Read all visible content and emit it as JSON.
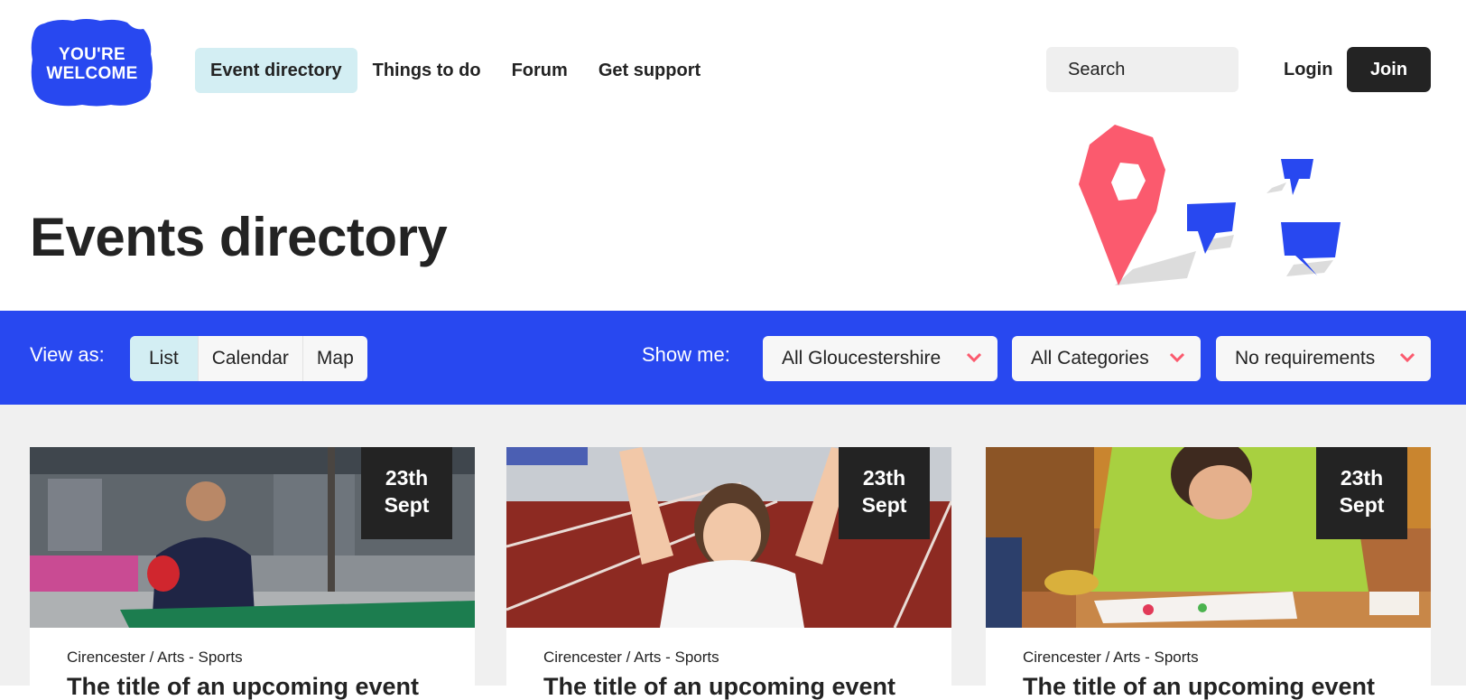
{
  "logo": {
    "line1": "YOU'RE",
    "line2": "WELCOME"
  },
  "nav": {
    "items": [
      {
        "label": "Event directory",
        "active": true
      },
      {
        "label": "Things to do",
        "active": false
      },
      {
        "label": "Forum",
        "active": false
      },
      {
        "label": "Get support",
        "active": false
      }
    ]
  },
  "search": {
    "placeholder": "Search"
  },
  "auth": {
    "login": "Login",
    "join": "Join"
  },
  "page": {
    "title": "Events directory"
  },
  "filters": {
    "view_label": "View as:",
    "view_options": [
      "List",
      "Calendar",
      "Map"
    ],
    "view_selected": "List",
    "show_label": "Show me:",
    "location": "All Gloucestershire",
    "category": "All Categories",
    "requirements": "No requirements"
  },
  "cards": [
    {
      "day": "23th",
      "month": "Sept",
      "meta": "Cirencester / Arts - Sports",
      "title": "The title of an upcoming event"
    },
    {
      "day": "23th",
      "month": "Sept",
      "meta": "Cirencester / Arts - Sports",
      "title": "The title of an upcoming event"
    },
    {
      "day": "23th",
      "month": "Sept",
      "meta": "Cirencester / Arts - Sports",
      "title": "The title of an upcoming event"
    }
  ],
  "colors": {
    "brand_blue": "#2848f0",
    "accent_pink": "#fb5a6e",
    "active_tint": "#d3eef3",
    "dark": "#232323"
  }
}
